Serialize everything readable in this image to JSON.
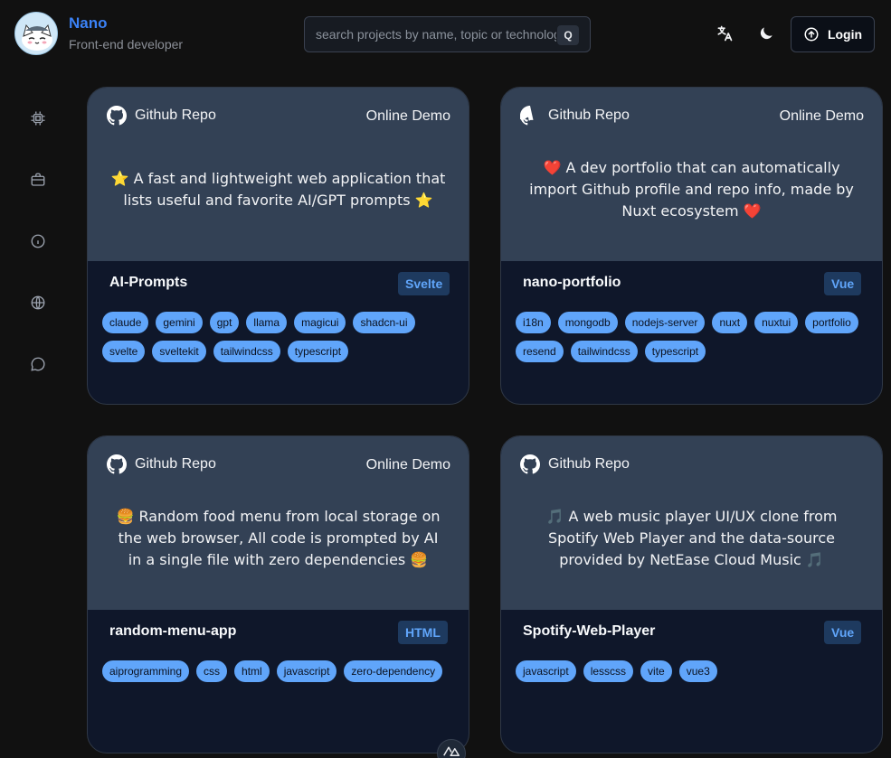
{
  "header": {
    "name": "Nano",
    "subtitle": "Front-end developer",
    "search": {
      "placeholder": "search projects by name, topic or technology",
      "shortcut": "Q"
    },
    "login_label": "Login",
    "icons": [
      "translate-icon",
      "moon-icon",
      "login-arrow-icon"
    ]
  },
  "sidebar": {
    "items": [
      "cpu-icon",
      "briefcase-icon",
      "info-icon",
      "globe-icon",
      "chat-icon"
    ]
  },
  "cards": [
    {
      "repo_label": "Github Repo",
      "demo_label": "Online Demo",
      "description": "⭐ A fast and lightweight web application that lists useful and favorite AI/GPT prompts ⭐",
      "name": "AI-Prompts",
      "language": "Svelte",
      "tags": [
        "claude",
        "gemini",
        "gpt",
        "llama",
        "magicui",
        "shadcn-ui",
        "svelte",
        "sveltekit",
        "tailwindcss",
        "typescript"
      ]
    },
    {
      "repo_label": "Github Repo",
      "demo_label": "Online Demo",
      "description": "❤️ A dev portfolio that can automatically import Github profile and repo info, made by Nuxt ecosystem ❤️",
      "name": "nano-portfolio",
      "language": "Vue",
      "tags": [
        "i18n",
        "mongodb",
        "nodejs-server",
        "nuxt",
        "nuxtui",
        "portfolio",
        "resend",
        "tailwindcss",
        "typescript"
      ]
    },
    {
      "repo_label": "Github Repo",
      "demo_label": "Online Demo",
      "description": "🍔 Random food menu from local storage on the web browser, All code is prompted by AI in a single file with zero dependencies 🍔",
      "name": "random-menu-app",
      "language": "HTML",
      "tags": [
        "aiprogramming",
        "css",
        "html",
        "javascript",
        "zero-dependency"
      ]
    },
    {
      "repo_label": "Github Repo",
      "description": "🎵 A web music player UI/UX clone from Spotify Web Player and the data-source provided by NetEase Cloud Music 🎵",
      "name": "Spotify-Web-Player",
      "language": "Vue",
      "tags": [
        "javascript",
        "lesscss",
        "vite",
        "vue3"
      ]
    }
  ],
  "colors": {
    "accent": "#3b82f6",
    "card_top": "#334155",
    "card_bottom": "#0f172a",
    "tag": "#60a5fa",
    "background": "#111111"
  }
}
